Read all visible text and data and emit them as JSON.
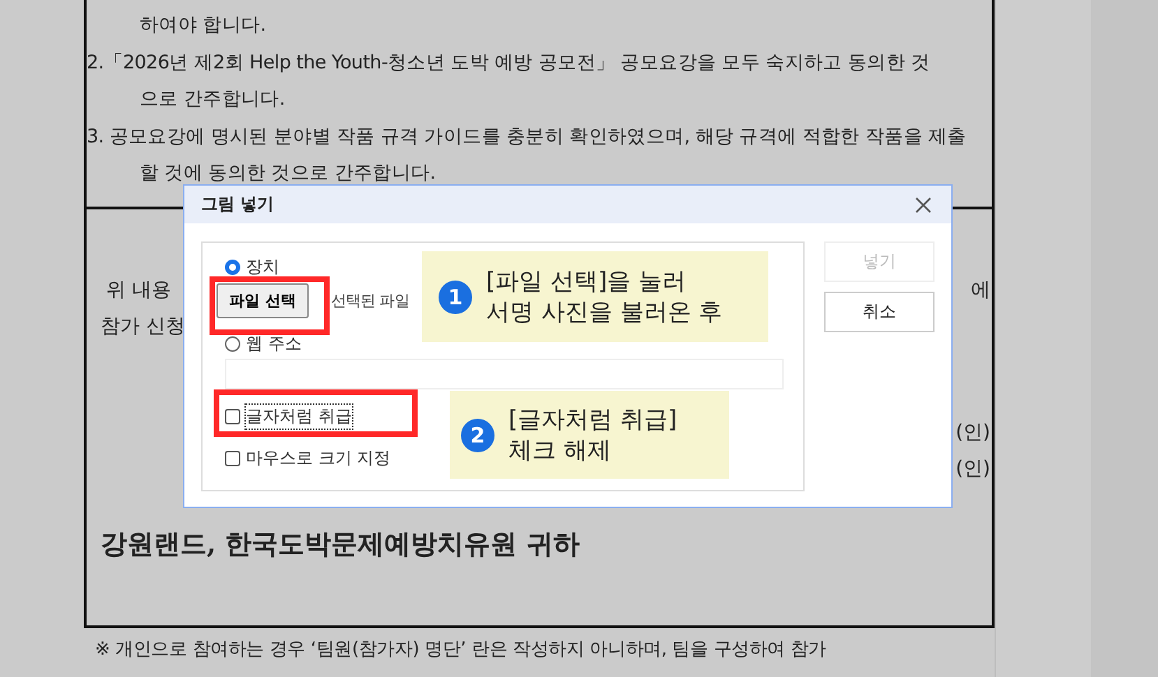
{
  "document": {
    "notice_lines": [
      {
        "kind": "continuation",
        "text": "하여야 합니다."
      },
      {
        "kind": "item",
        "text": "2.「2026년 제2회 Help the Youth-청소년 도박 예방 공모전」 공모요강을 모두 숙지하고 동의한 것"
      },
      {
        "kind": "continuation",
        "text": "으로 간주합니다."
      },
      {
        "kind": "item",
        "text": "3. 공모요강에 명시된 분야별 작품 규격 가이드를 충분히 확인하였으며, 해당 규격에 적합한 작품을 제출"
      },
      {
        "kind": "continuation",
        "text": "할 것에 동의한 것으로 간주합니다."
      }
    ],
    "statement_left": [
      "위 내용",
      "참가 신청"
    ],
    "statement_right": "에",
    "seal_marks": [
      "(인)",
      "(인)"
    ],
    "addressee": "강원랜드, 한국도박문제예방치유원 귀하",
    "footnote": "※ 개인으로 참여하는 경우 ‘팀원(참가자) 명단’ 란은 작성하지 아니하며, 팀을 구성하여 참가"
  },
  "dialog": {
    "title": "그림 넣기",
    "sources": [
      {
        "label": "장치",
        "selected": true
      },
      {
        "label": "웹 주소",
        "selected": false
      }
    ],
    "file_button": "파일 선택",
    "file_status": "선택된 파일",
    "options": [
      {
        "label": "글자처럼 취급",
        "checked": false,
        "focused": true
      },
      {
        "label": "마우스로 크기 지정",
        "checked": false,
        "focused": false
      }
    ],
    "buttons": [
      {
        "label": "넣기",
        "disabled": true
      },
      {
        "label": "취소",
        "disabled": false
      }
    ]
  },
  "annotations": [
    {
      "number": "1",
      "lines": [
        "[파일 선택]을 눌러",
        "서명 사진을 불러온 후"
      ]
    },
    {
      "number": "2",
      "lines": [
        "[글자처럼 취급]",
        "체크 해제"
      ]
    }
  ]
}
